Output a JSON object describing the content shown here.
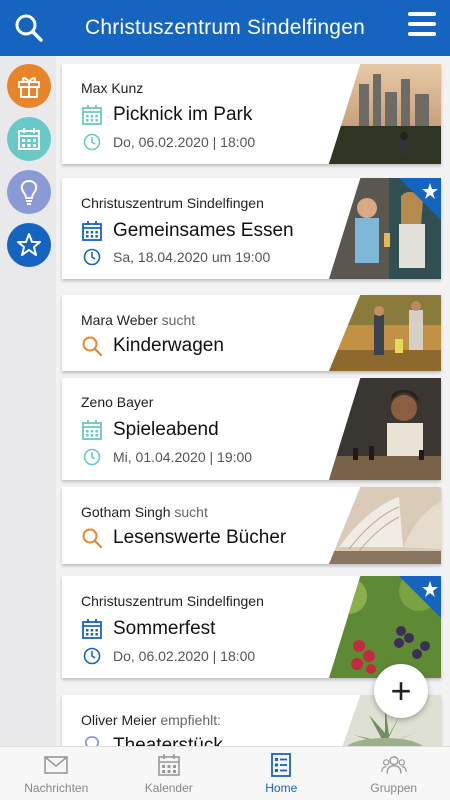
{
  "header": {
    "title": "Christuszentrum Sindelfingen"
  },
  "filters": [
    {
      "name": "gift-icon",
      "color": "#e8852a"
    },
    {
      "name": "calendar-icon",
      "color": "#69c9c6"
    },
    {
      "name": "lightbulb-icon",
      "color": "#8a9ad4"
    },
    {
      "name": "star-icon",
      "color": "#1565c0"
    }
  ],
  "cards": [
    {
      "author": "Max Kunz",
      "verb": "",
      "icon": "calendar-icon",
      "name": "Picknick im Park",
      "date": "Do, 06.02.2020 | 18:00",
      "favorite": false
    },
    {
      "author": "Christuszentrum Sindelfingen",
      "verb": "",
      "icon": "calendar-icon",
      "name": "Gemeinsames Essen",
      "date": "Sa, 18.04.2020 um 19:00",
      "favorite": true
    },
    {
      "author": "Mara Weber",
      "verb": "sucht",
      "icon": "search-icon",
      "name": "Kinderwagen",
      "date": "",
      "favorite": false
    },
    {
      "author": "Zeno Bayer",
      "verb": "",
      "icon": "calendar-icon",
      "name": "Spieleabend",
      "date": "Mi, 01.04.2020 | 19:00",
      "favorite": false
    },
    {
      "author": "Gotham Singh",
      "verb": "sucht",
      "icon": "search-icon",
      "name": "Lesenswerte Bücher",
      "date": "",
      "favorite": false
    },
    {
      "author": "Christuszentrum Sindelfingen",
      "verb": "",
      "icon": "calendar-icon",
      "name": "Sommerfest",
      "date": "Do, 06.02.2020 | 18:00",
      "favorite": true
    },
    {
      "author": "Oliver Meier",
      "verb": "empfiehlt:",
      "icon": "bulb-icon",
      "name": "Theaterstück",
      "date": "",
      "favorite": false
    }
  ],
  "fab": {
    "label": "+"
  },
  "nav": [
    {
      "label": "Nachrichten",
      "icon": "mail-icon",
      "active": false
    },
    {
      "label": "Kalender",
      "icon": "calendar-icon",
      "active": false
    },
    {
      "label": "Home",
      "icon": "home-list-icon",
      "active": true
    },
    {
      "label": "Gruppen",
      "icon": "group-icon",
      "active": false
    }
  ],
  "colors": {
    "brand": "#1565c0",
    "calendar_teal": "#69c9c6",
    "search_orange": "#e8852a"
  }
}
